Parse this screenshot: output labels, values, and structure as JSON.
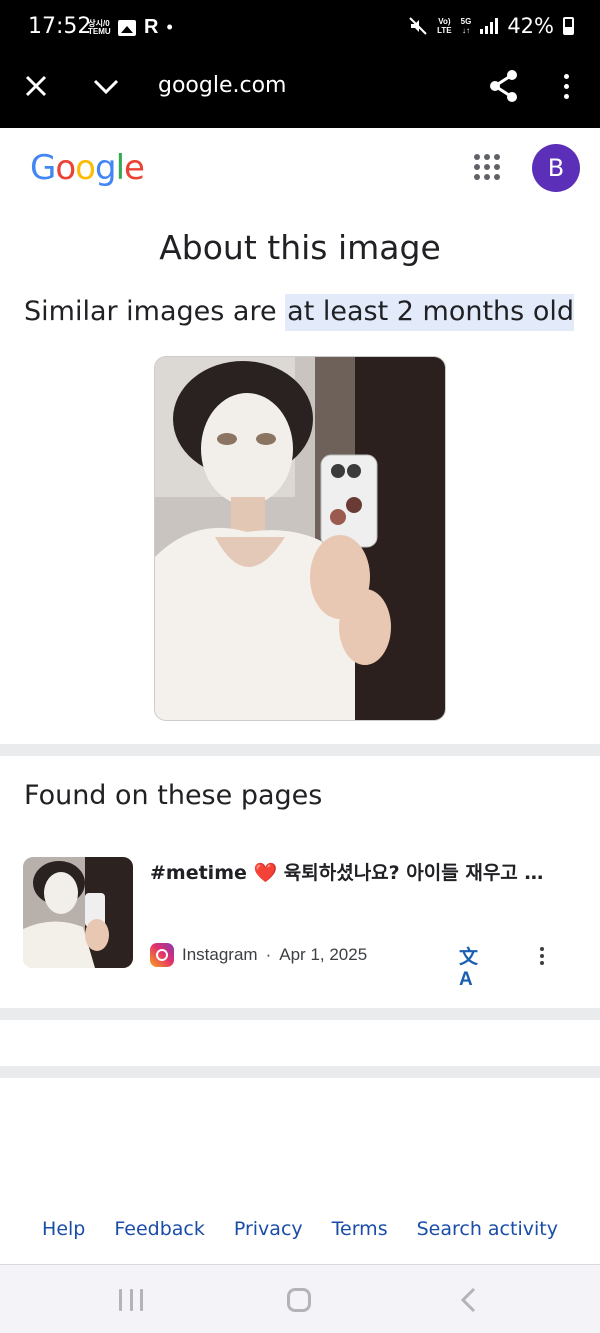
{
  "status_bar": {
    "time": "17:52",
    "temu_top": "상시/0",
    "temu_bottom": "TEMU",
    "r_label": "R",
    "dot": "•",
    "lte_top": "Vo)",
    "lte_bottom": "LTE",
    "fiveg_top": "5G",
    "fiveg_bottom": "↓↑",
    "battery": "42%",
    "icons": [
      "temu-icon",
      "gallery-icon",
      "r-icon",
      "mute-icon",
      "volte-icon",
      "5g-icon",
      "signal-icon",
      "battery-icon"
    ]
  },
  "toolbar": {
    "url": "google.com",
    "icons": [
      "close-icon",
      "chevron-down-icon",
      "share-icon",
      "more-vert-icon"
    ]
  },
  "header": {
    "logo_letters": [
      {
        "char": "G",
        "color": "#4285F4"
      },
      {
        "char": "o",
        "color": "#EA4335"
      },
      {
        "char": "o",
        "color": "#FBBC05"
      },
      {
        "char": "g",
        "color": "#4285F4"
      },
      {
        "char": "l",
        "color": "#34A853"
      },
      {
        "char": "e",
        "color": "#EA4335"
      }
    ],
    "avatar_letter": "B",
    "avatar_color": "#5b2fb8"
  },
  "main": {
    "title": "About this image",
    "age_prefix": "Similar images are ",
    "age_highlight": "at least 2 months old",
    "found_title": "Found on these pages"
  },
  "result": {
    "title": "#metime ❤️ 육퇴하셨나요? 아이들 재우고 피...",
    "source": "Instagram",
    "separator": "·",
    "date": "Apr 1, 2025",
    "translate_icon": "文A"
  },
  "footer": {
    "help": "Help",
    "feedback": "Feedback",
    "privacy": "Privacy",
    "terms": "Terms",
    "search_activity": "Search activity"
  },
  "nav_bar": {
    "icons": [
      "recents-icon",
      "home-icon",
      "back-icon"
    ]
  }
}
